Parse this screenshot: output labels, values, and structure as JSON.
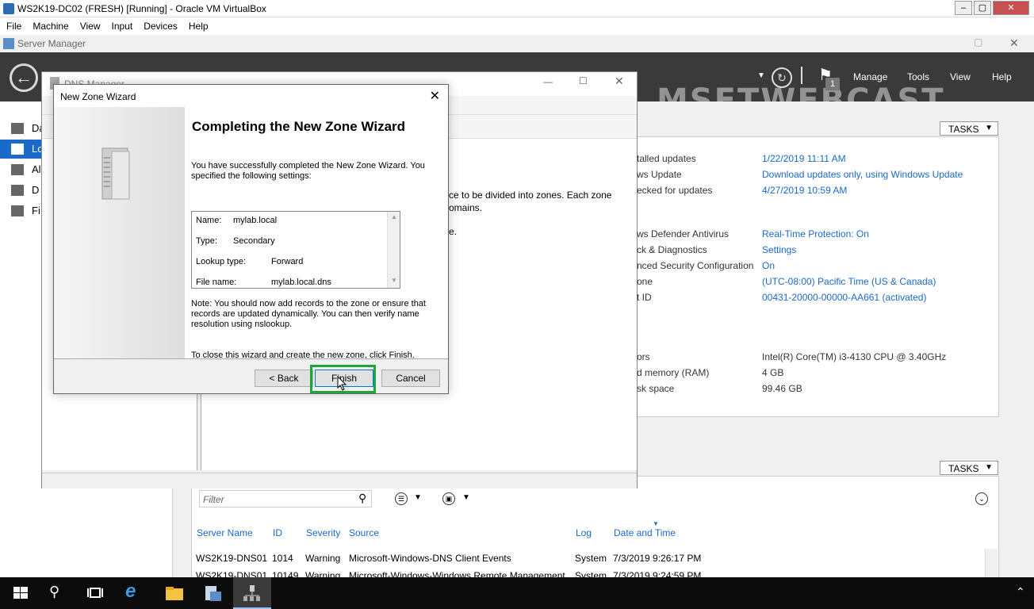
{
  "vbox": {
    "title": "WS2K19-DC02 (FRESH) [Running] - Oracle VM VirtualBox",
    "menu": [
      "File",
      "Machine",
      "View",
      "Input",
      "Devices",
      "Help"
    ]
  },
  "server_manager": {
    "title": "Server Manager",
    "watermark": "MSFTWEBCAST",
    "notification_count": "1",
    "nav": [
      "Manage",
      "Tools",
      "View",
      "Help"
    ],
    "left_nav": [
      "Da",
      "Lo",
      "Al",
      "D",
      "Fi"
    ],
    "tasks_label": "TASKS",
    "properties": [
      {
        "label": "talled updates",
        "value": "1/22/2019 11:11 AM",
        "link": true
      },
      {
        "label": "ws Update",
        "value": "Download updates only, using Windows Update",
        "link": true
      },
      {
        "label": "ecked for updates",
        "value": "4/27/2019 10:59 AM",
        "link": true
      },
      {
        "label": "ws Defender Antivirus",
        "value": "Real-Time Protection: On",
        "link": true
      },
      {
        "label": "ck & Diagnostics",
        "value": "Settings",
        "link": true
      },
      {
        "label": "nced Security Configuration",
        "value": "On",
        "link": true
      },
      {
        "label": "one",
        "value": "(UTC-08:00) Pacific Time (US & Canada)",
        "link": true
      },
      {
        "label": "t ID",
        "value": "00431-20000-00000-AA661 (activated)",
        "link": true
      },
      {
        "label": "ors",
        "value": "Intel(R) Core(TM) i3-4130 CPU @ 3.40GHz",
        "link": false
      },
      {
        "label": "d memory (RAM)",
        "value": "4 GB",
        "link": false
      },
      {
        "label": "sk space",
        "value": "99.46 GB",
        "link": false
      }
    ],
    "events": {
      "filter_placeholder": "Filter",
      "columns": [
        "Server Name",
        "ID",
        "Severity",
        "Source",
        "Log",
        "Date and Time"
      ],
      "rows": [
        {
          "server": "WS2K19-DNS01",
          "id": "1014",
          "severity": "Warning",
          "source": "Microsoft-Windows-DNS Client Events",
          "log": "System",
          "time": "7/3/2019 9:26:17 PM"
        },
        {
          "server": "WS2K19-DNS01",
          "id": "10149",
          "severity": "Warning",
          "source": "Microsoft-Windows-Windows Remote Management",
          "log": "System",
          "time": "7/3/2019 9:24:59 PM"
        }
      ]
    }
  },
  "dns_manager": {
    "title": "DNS Manager",
    "bg_text_1": "ce to be divided into zones. Each zone",
    "bg_text_2": "omains.",
    "bg_text_3": "e."
  },
  "wizard": {
    "title": "New Zone Wizard",
    "heading": "Completing the New Zone Wizard",
    "intro": "You have successfully completed the New Zone Wizard. You specified the following settings:",
    "settings": [
      {
        "label": "Name:",
        "value": "mylab.local"
      },
      {
        "label": "Type:",
        "value": "Secondary"
      },
      {
        "label": "Lookup type:",
        "value": "Forward"
      },
      {
        "label": "File name:",
        "value": "mylab.local.dns"
      }
    ],
    "note": "Note: You should now add records to the zone or ensure that records are updated dynamically. You can then verify name resolution using nslookup.",
    "close_text": "To close this wizard and create the new zone, click Finish.",
    "buttons": {
      "back": "< Back",
      "finish": "Finish",
      "cancel": "Cancel"
    }
  }
}
